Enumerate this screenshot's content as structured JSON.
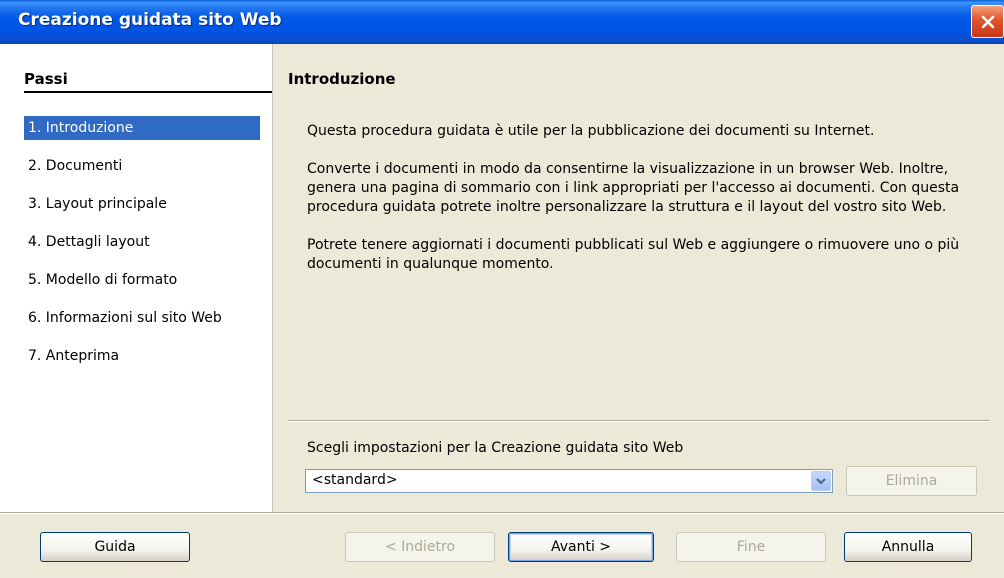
{
  "window": {
    "title": "Creazione guidata sito Web"
  },
  "steps": {
    "header": "Passi",
    "items": [
      {
        "label": "1. Introduzione",
        "active": true
      },
      {
        "label": "2. Documenti"
      },
      {
        "label": "3. Layout principale"
      },
      {
        "label": "4. Dettagli layout"
      },
      {
        "label": "5. Modello di formato"
      },
      {
        "label": "6. Informazioni sul sito Web"
      },
      {
        "label": "7. Anteprima"
      }
    ]
  },
  "main": {
    "title": "Introduzione",
    "paragraphs": [
      "Questa procedura guidata è utile per la pubblicazione dei documenti su Internet.",
      "Converte i documenti in modo da consentirne la visualizzazione in un browser Web. Inoltre, genera una pagina di sommario con i link appropriati per l'accesso ai documenti. Con questa procedura guidata potrete inoltre personalizzare la struttura e il layout del vostro sito Web.",
      "Potrete tenere aggiornati i documenti pubblicati sul Web e aggiungere o rimuovere uno o più documenti in qualunque momento."
    ],
    "settings_label": "Scegli impostazioni per la Creazione guidata sito Web",
    "settings_value": "<standard>",
    "delete_label": "Elimina"
  },
  "footer": {
    "help": "Guida",
    "back": "< Indietro",
    "next": "Avanti >",
    "finish": "Fine",
    "cancel": "Annulla"
  },
  "icons": {
    "close": "close-icon",
    "dropdown": "chevron-down-icon"
  },
  "colors": {
    "titlebar": "#0054e3",
    "selection": "#316ac5",
    "close": "#e2542a",
    "window_bg": "#ece9d8"
  }
}
